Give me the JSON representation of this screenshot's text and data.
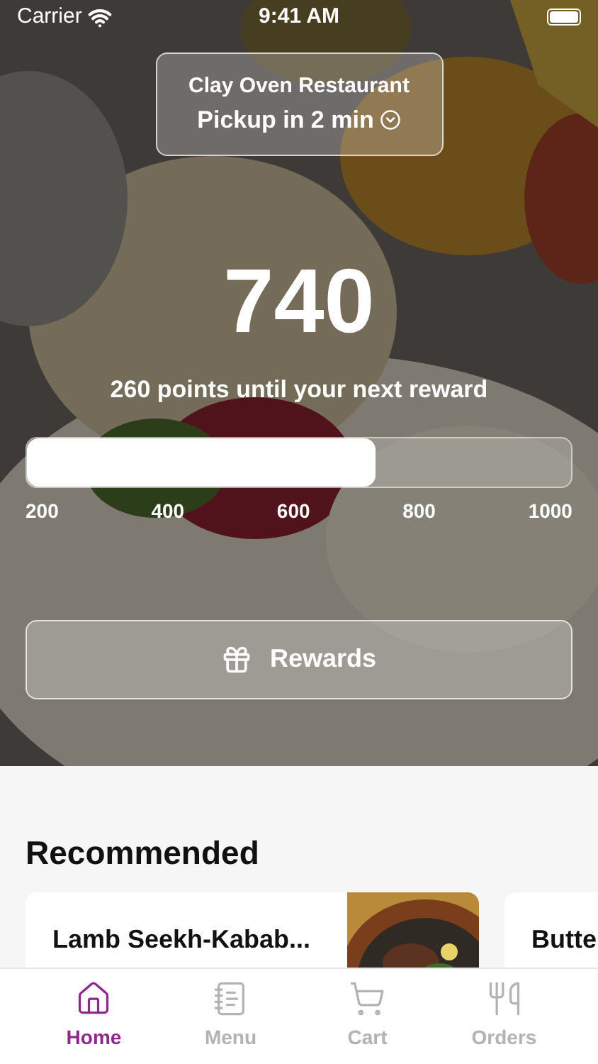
{
  "status_bar": {
    "carrier": "Carrier",
    "time": "9:41 AM"
  },
  "location": {
    "restaurant": "Clay Oven Restaurant",
    "pickup": "Pickup in 2 min"
  },
  "points": {
    "value": "740",
    "caption": "260 points until your next reward",
    "level": 0.64,
    "ticks": [
      "200",
      "400",
      "600",
      "800",
      "1000"
    ]
  },
  "rewards_button": {
    "label": "Rewards"
  },
  "recommended": {
    "title": "Recommended",
    "items": [
      {
        "name": "Lamb Seekh-Kabab...",
        "kind": "picture"
      },
      {
        "name": "Butte"
      }
    ]
  },
  "tabs": [
    {
      "label": "Home",
      "kind": "home",
      "selected": true
    },
    {
      "label": "Menu",
      "kind": "menu",
      "selected": false
    },
    {
      "label": "Cart",
      "kind": "cart",
      "selected": false
    },
    {
      "label": "Orders",
      "kind": "orders",
      "selected": false
    }
  ]
}
